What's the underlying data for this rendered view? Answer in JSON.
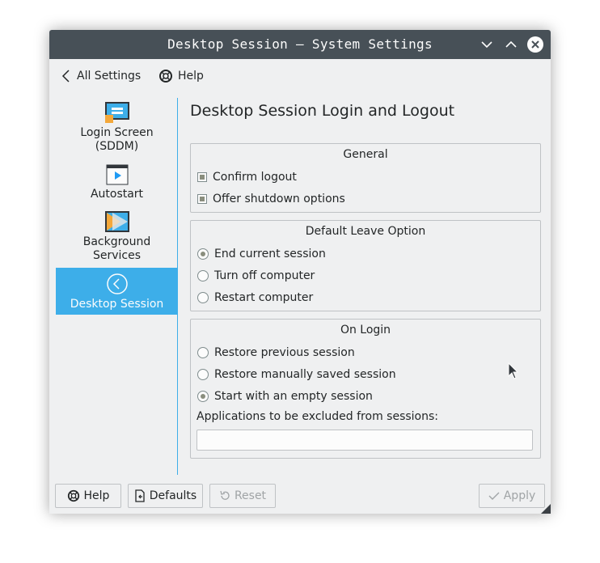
{
  "window": {
    "title": "Desktop Session — System Settings"
  },
  "titlebar": {
    "buttons": [
      "minimize-icon",
      "maximize-icon",
      "close-icon"
    ]
  },
  "nav": {
    "back_label": "All Settings",
    "help_label": "Help"
  },
  "sidebar": {
    "items": [
      {
        "label": "Login Screen\n(SDDM)",
        "icon": "login-screen-icon",
        "active": false
      },
      {
        "label": "Autostart",
        "icon": "autostart-icon",
        "active": false
      },
      {
        "label": "Background\nServices",
        "icon": "background-services-icon",
        "active": false
      },
      {
        "label": "Desktop Session",
        "icon": "desktop-session-icon",
        "active": true
      }
    ]
  },
  "main": {
    "title": "Desktop Session Login and Logout",
    "general": {
      "title": "General",
      "confirm_logout": {
        "label": "Confirm logout",
        "checked": true
      },
      "offer_shutdown": {
        "label": "Offer shutdown options",
        "checked": true
      }
    },
    "leave": {
      "title": "Default Leave Option",
      "options": [
        {
          "label": "End current session",
          "checked": true
        },
        {
          "label": "Turn off computer",
          "checked": false
        },
        {
          "label": "Restart computer",
          "checked": false
        }
      ]
    },
    "login": {
      "title": "On Login",
      "options": [
        {
          "label": "Restore previous session",
          "checked": false
        },
        {
          "label": "Restore manually saved session",
          "checked": false
        },
        {
          "label": "Start with an empty session",
          "checked": true
        }
      ],
      "exclude_label": "Applications to be excluded from sessions:",
      "exclude_value": ""
    }
  },
  "footer": {
    "help_label": "Help",
    "defaults_label": "Defaults",
    "reset_label": "Reset",
    "apply_label": "Apply"
  },
  "colors": {
    "accent": "#3daee9",
    "titlebar": "#475057",
    "window_bg": "#eff0f1"
  }
}
